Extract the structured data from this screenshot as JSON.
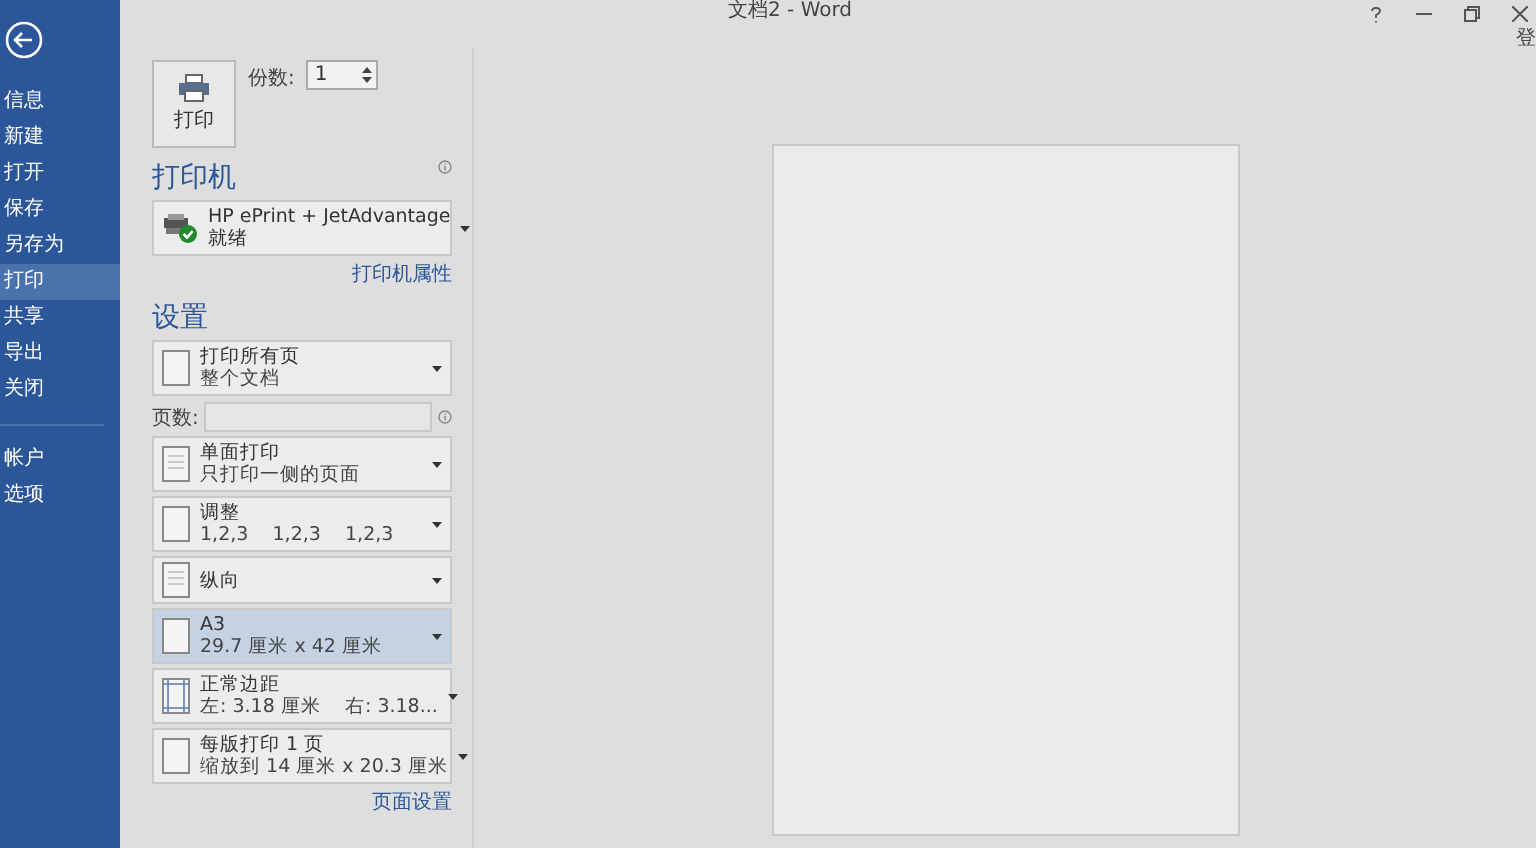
{
  "window": {
    "title": "文档2 - Word",
    "sign_in": "登"
  },
  "sidebar": {
    "items": [
      {
        "label": "信息",
        "selected": false
      },
      {
        "label": "新建",
        "selected": false
      },
      {
        "label": "打开",
        "selected": false
      },
      {
        "label": "保存",
        "selected": false
      },
      {
        "label": "另存为",
        "selected": false
      },
      {
        "label": "打印",
        "selected": true
      },
      {
        "label": "共享",
        "selected": false
      },
      {
        "label": "导出",
        "selected": false
      },
      {
        "label": "关闭",
        "selected": false
      }
    ],
    "bottom_items": [
      {
        "label": "帐户",
        "selected": false
      },
      {
        "label": "选项",
        "selected": false
      }
    ]
  },
  "print": {
    "button": "打印",
    "copies_label": "份数:",
    "copies": "1"
  },
  "printer": {
    "heading": "打印机",
    "name": "HP ePrint + JetAdvantage",
    "status": "就绪",
    "properties_link": "打印机属性"
  },
  "settings": {
    "heading": "设置",
    "pages_label": "页数:",
    "page_setup_link": "页面设置",
    "dropdowns": [
      {
        "title": "打印所有页",
        "subtitle": "整个文档",
        "selected": false
      },
      {
        "title": "单面打印",
        "subtitle": "只打印一侧的页面",
        "selected": false
      },
      {
        "title": "调整",
        "subtitle": "1,2,3    1,2,3    1,2,3",
        "selected": false
      },
      {
        "title": "纵向",
        "selected": false
      },
      {
        "title": "A3",
        "subtitle": "29.7 厘米 x 42 厘米",
        "selected": true
      },
      {
        "title": "正常边距",
        "subtitle": "左: 3.18 厘米    右: 3.18...",
        "selected": false
      },
      {
        "title": "每版打印 1 页",
        "subtitle": "缩放到 14 厘米 x 20.3 厘米",
        "selected": false
      }
    ]
  }
}
